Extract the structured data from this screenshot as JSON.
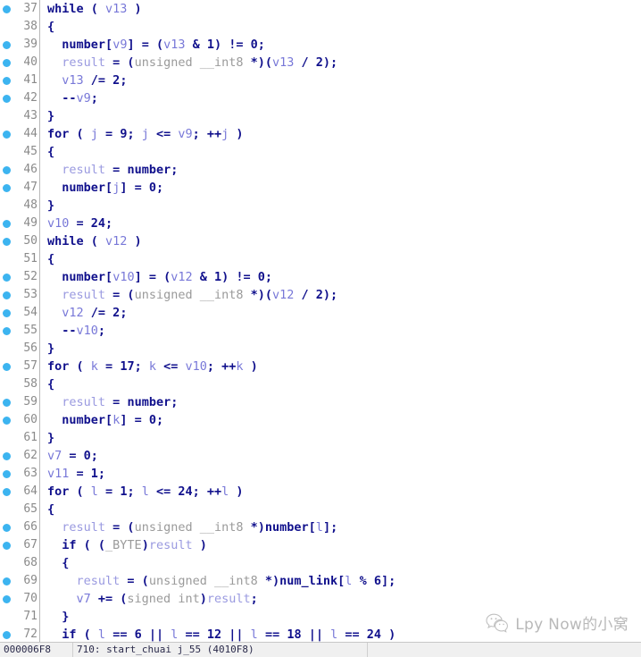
{
  "editor": {
    "name": "pseudocode-view",
    "first_line": 37,
    "lines": [
      {
        "num": 37,
        "breakpoint": true,
        "tokens": [
          {
            "t": "kw",
            "s": "while"
          },
          {
            "t": "punc",
            "s": " ( "
          },
          {
            "t": "var",
            "s": "v13"
          },
          {
            "t": "punc",
            "s": " )"
          }
        ]
      },
      {
        "num": 38,
        "breakpoint": false,
        "tokens": [
          {
            "t": "punc",
            "s": "{"
          }
        ]
      },
      {
        "num": 39,
        "breakpoint": true,
        "tokens": [
          {
            "t": "punc",
            "s": "  "
          },
          {
            "t": "ident",
            "s": "number"
          },
          {
            "t": "punc",
            "s": "["
          },
          {
            "t": "var",
            "s": "v9"
          },
          {
            "t": "punc",
            "s": "] = ("
          },
          {
            "t": "var",
            "s": "v13"
          },
          {
            "t": "punc",
            "s": " & "
          },
          {
            "t": "num",
            "s": "1"
          },
          {
            "t": "punc",
            "s": ") != "
          },
          {
            "t": "num",
            "s": "0"
          },
          {
            "t": "punc",
            "s": ";"
          }
        ]
      },
      {
        "num": 40,
        "breakpoint": true,
        "tokens": [
          {
            "t": "punc",
            "s": "  "
          },
          {
            "t": "res",
            "s": "result"
          },
          {
            "t": "punc",
            "s": " = ("
          },
          {
            "t": "type",
            "s": "unsigned __int8"
          },
          {
            "t": "punc",
            "s": " *)("
          },
          {
            "t": "var",
            "s": "v13"
          },
          {
            "t": "punc",
            "s": " / "
          },
          {
            "t": "num",
            "s": "2"
          },
          {
            "t": "punc",
            "s": ");"
          }
        ]
      },
      {
        "num": 41,
        "breakpoint": true,
        "tokens": [
          {
            "t": "punc",
            "s": "  "
          },
          {
            "t": "var",
            "s": "v13"
          },
          {
            "t": "punc",
            "s": " /= "
          },
          {
            "t": "num",
            "s": "2"
          },
          {
            "t": "punc",
            "s": ";"
          }
        ]
      },
      {
        "num": 42,
        "breakpoint": true,
        "tokens": [
          {
            "t": "punc",
            "s": "  --"
          },
          {
            "t": "var",
            "s": "v9"
          },
          {
            "t": "punc",
            "s": ";"
          }
        ]
      },
      {
        "num": 43,
        "breakpoint": false,
        "tokens": [
          {
            "t": "punc",
            "s": "}"
          }
        ]
      },
      {
        "num": 44,
        "breakpoint": true,
        "tokens": [
          {
            "t": "kw",
            "s": "for"
          },
          {
            "t": "punc",
            "s": " ( "
          },
          {
            "t": "var",
            "s": "j"
          },
          {
            "t": "punc",
            "s": " = "
          },
          {
            "t": "num",
            "s": "9"
          },
          {
            "t": "punc",
            "s": "; "
          },
          {
            "t": "var",
            "s": "j"
          },
          {
            "t": "punc",
            "s": " <= "
          },
          {
            "t": "var",
            "s": "v9"
          },
          {
            "t": "punc",
            "s": "; ++"
          },
          {
            "t": "var",
            "s": "j"
          },
          {
            "t": "punc",
            "s": " )"
          }
        ]
      },
      {
        "num": 45,
        "breakpoint": false,
        "tokens": [
          {
            "t": "punc",
            "s": "{"
          }
        ]
      },
      {
        "num": 46,
        "breakpoint": true,
        "tokens": [
          {
            "t": "punc",
            "s": "  "
          },
          {
            "t": "res",
            "s": "result"
          },
          {
            "t": "punc",
            "s": " = "
          },
          {
            "t": "ident",
            "s": "number"
          },
          {
            "t": "punc",
            "s": ";"
          }
        ]
      },
      {
        "num": 47,
        "breakpoint": true,
        "tokens": [
          {
            "t": "punc",
            "s": "  "
          },
          {
            "t": "ident",
            "s": "number"
          },
          {
            "t": "punc",
            "s": "["
          },
          {
            "t": "var",
            "s": "j"
          },
          {
            "t": "punc",
            "s": "] = "
          },
          {
            "t": "num",
            "s": "0"
          },
          {
            "t": "punc",
            "s": ";"
          }
        ]
      },
      {
        "num": 48,
        "breakpoint": false,
        "tokens": [
          {
            "t": "punc",
            "s": "}"
          }
        ]
      },
      {
        "num": 49,
        "breakpoint": true,
        "tokens": [
          {
            "t": "var",
            "s": "v10"
          },
          {
            "t": "punc",
            "s": " = "
          },
          {
            "t": "num",
            "s": "24"
          },
          {
            "t": "punc",
            "s": ";"
          }
        ]
      },
      {
        "num": 50,
        "breakpoint": true,
        "tokens": [
          {
            "t": "kw",
            "s": "while"
          },
          {
            "t": "punc",
            "s": " ( "
          },
          {
            "t": "var",
            "s": "v12"
          },
          {
            "t": "punc",
            "s": " )"
          }
        ]
      },
      {
        "num": 51,
        "breakpoint": false,
        "tokens": [
          {
            "t": "punc",
            "s": "{"
          }
        ]
      },
      {
        "num": 52,
        "breakpoint": true,
        "tokens": [
          {
            "t": "punc",
            "s": "  "
          },
          {
            "t": "ident",
            "s": "number"
          },
          {
            "t": "punc",
            "s": "["
          },
          {
            "t": "var",
            "s": "v10"
          },
          {
            "t": "punc",
            "s": "] = ("
          },
          {
            "t": "var",
            "s": "v12"
          },
          {
            "t": "punc",
            "s": " & "
          },
          {
            "t": "num",
            "s": "1"
          },
          {
            "t": "punc",
            "s": ") != "
          },
          {
            "t": "num",
            "s": "0"
          },
          {
            "t": "punc",
            "s": ";"
          }
        ]
      },
      {
        "num": 53,
        "breakpoint": true,
        "tokens": [
          {
            "t": "punc",
            "s": "  "
          },
          {
            "t": "res",
            "s": "result"
          },
          {
            "t": "punc",
            "s": " = ("
          },
          {
            "t": "type",
            "s": "unsigned __int8"
          },
          {
            "t": "punc",
            "s": " *)("
          },
          {
            "t": "var",
            "s": "v12"
          },
          {
            "t": "punc",
            "s": " / "
          },
          {
            "t": "num",
            "s": "2"
          },
          {
            "t": "punc",
            "s": ");"
          }
        ]
      },
      {
        "num": 54,
        "breakpoint": true,
        "tokens": [
          {
            "t": "punc",
            "s": "  "
          },
          {
            "t": "var",
            "s": "v12"
          },
          {
            "t": "punc",
            "s": " /= "
          },
          {
            "t": "num",
            "s": "2"
          },
          {
            "t": "punc",
            "s": ";"
          }
        ]
      },
      {
        "num": 55,
        "breakpoint": true,
        "tokens": [
          {
            "t": "punc",
            "s": "  --"
          },
          {
            "t": "var",
            "s": "v10"
          },
          {
            "t": "punc",
            "s": ";"
          }
        ]
      },
      {
        "num": 56,
        "breakpoint": false,
        "tokens": [
          {
            "t": "punc",
            "s": "}"
          }
        ]
      },
      {
        "num": 57,
        "breakpoint": true,
        "tokens": [
          {
            "t": "kw",
            "s": "for"
          },
          {
            "t": "punc",
            "s": " ( "
          },
          {
            "t": "var",
            "s": "k"
          },
          {
            "t": "punc",
            "s": " = "
          },
          {
            "t": "num",
            "s": "17"
          },
          {
            "t": "punc",
            "s": "; "
          },
          {
            "t": "var",
            "s": "k"
          },
          {
            "t": "punc",
            "s": " <= "
          },
          {
            "t": "var",
            "s": "v10"
          },
          {
            "t": "punc",
            "s": "; ++"
          },
          {
            "t": "var",
            "s": "k"
          },
          {
            "t": "punc",
            "s": " )"
          }
        ]
      },
      {
        "num": 58,
        "breakpoint": false,
        "tokens": [
          {
            "t": "punc",
            "s": "{"
          }
        ]
      },
      {
        "num": 59,
        "breakpoint": true,
        "tokens": [
          {
            "t": "punc",
            "s": "  "
          },
          {
            "t": "res",
            "s": "result"
          },
          {
            "t": "punc",
            "s": " = "
          },
          {
            "t": "ident",
            "s": "number"
          },
          {
            "t": "punc",
            "s": ";"
          }
        ]
      },
      {
        "num": 60,
        "breakpoint": true,
        "tokens": [
          {
            "t": "punc",
            "s": "  "
          },
          {
            "t": "ident",
            "s": "number"
          },
          {
            "t": "punc",
            "s": "["
          },
          {
            "t": "var",
            "s": "k"
          },
          {
            "t": "punc",
            "s": "] = "
          },
          {
            "t": "num",
            "s": "0"
          },
          {
            "t": "punc",
            "s": ";"
          }
        ]
      },
      {
        "num": 61,
        "breakpoint": false,
        "tokens": [
          {
            "t": "punc",
            "s": "}"
          }
        ]
      },
      {
        "num": 62,
        "breakpoint": true,
        "tokens": [
          {
            "t": "var",
            "s": "v7"
          },
          {
            "t": "punc",
            "s": " = "
          },
          {
            "t": "num",
            "s": "0"
          },
          {
            "t": "punc",
            "s": ";"
          }
        ]
      },
      {
        "num": 63,
        "breakpoint": true,
        "tokens": [
          {
            "t": "var",
            "s": "v11"
          },
          {
            "t": "punc",
            "s": " = "
          },
          {
            "t": "num",
            "s": "1"
          },
          {
            "t": "punc",
            "s": ";"
          }
        ]
      },
      {
        "num": 64,
        "breakpoint": true,
        "tokens": [
          {
            "t": "kw",
            "s": "for"
          },
          {
            "t": "punc",
            "s": " ( "
          },
          {
            "t": "var",
            "s": "l"
          },
          {
            "t": "punc",
            "s": " = "
          },
          {
            "t": "num",
            "s": "1"
          },
          {
            "t": "punc",
            "s": "; "
          },
          {
            "t": "var",
            "s": "l"
          },
          {
            "t": "punc",
            "s": " <= "
          },
          {
            "t": "num",
            "s": "24"
          },
          {
            "t": "punc",
            "s": "; ++"
          },
          {
            "t": "var",
            "s": "l"
          },
          {
            "t": "punc",
            "s": " )"
          }
        ]
      },
      {
        "num": 65,
        "breakpoint": false,
        "tokens": [
          {
            "t": "punc",
            "s": "{"
          }
        ]
      },
      {
        "num": 66,
        "breakpoint": true,
        "tokens": [
          {
            "t": "punc",
            "s": "  "
          },
          {
            "t": "res",
            "s": "result"
          },
          {
            "t": "punc",
            "s": " = ("
          },
          {
            "t": "type",
            "s": "unsigned __int8"
          },
          {
            "t": "punc",
            "s": " *)"
          },
          {
            "t": "ident",
            "s": "number"
          },
          {
            "t": "punc",
            "s": "["
          },
          {
            "t": "var",
            "s": "l"
          },
          {
            "t": "punc",
            "s": "];"
          }
        ]
      },
      {
        "num": 67,
        "breakpoint": true,
        "tokens": [
          {
            "t": "punc",
            "s": "  "
          },
          {
            "t": "kw",
            "s": "if"
          },
          {
            "t": "punc",
            "s": " ( ("
          },
          {
            "t": "type",
            "s": "_BYTE"
          },
          {
            "t": "punc",
            "s": ")"
          },
          {
            "t": "res",
            "s": "result"
          },
          {
            "t": "punc",
            "s": " )"
          }
        ]
      },
      {
        "num": 68,
        "breakpoint": false,
        "tokens": [
          {
            "t": "punc",
            "s": "  {"
          }
        ]
      },
      {
        "num": 69,
        "breakpoint": true,
        "tokens": [
          {
            "t": "punc",
            "s": "    "
          },
          {
            "t": "res",
            "s": "result"
          },
          {
            "t": "punc",
            "s": " = ("
          },
          {
            "t": "type",
            "s": "unsigned __int8"
          },
          {
            "t": "punc",
            "s": " *)"
          },
          {
            "t": "ident",
            "s": "num_link"
          },
          {
            "t": "punc",
            "s": "["
          },
          {
            "t": "var",
            "s": "l"
          },
          {
            "t": "punc",
            "s": " % "
          },
          {
            "t": "num",
            "s": "6"
          },
          {
            "t": "punc",
            "s": "];"
          }
        ]
      },
      {
        "num": 70,
        "breakpoint": true,
        "tokens": [
          {
            "t": "punc",
            "s": "    "
          },
          {
            "t": "var",
            "s": "v7"
          },
          {
            "t": "punc",
            "s": " += ("
          },
          {
            "t": "type",
            "s": "signed int"
          },
          {
            "t": "punc",
            "s": ")"
          },
          {
            "t": "res",
            "s": "result"
          },
          {
            "t": "punc",
            "s": ";"
          }
        ]
      },
      {
        "num": 71,
        "breakpoint": false,
        "tokens": [
          {
            "t": "punc",
            "s": "  }"
          }
        ]
      },
      {
        "num": 72,
        "breakpoint": true,
        "tokens": [
          {
            "t": "punc",
            "s": "  "
          },
          {
            "t": "kw",
            "s": "if"
          },
          {
            "t": "punc",
            "s": " ( "
          },
          {
            "t": "var",
            "s": "l"
          },
          {
            "t": "punc",
            "s": " == "
          },
          {
            "t": "num",
            "s": "6"
          },
          {
            "t": "punc",
            "s": " || "
          },
          {
            "t": "var",
            "s": "l"
          },
          {
            "t": "punc",
            "s": " == "
          },
          {
            "t": "num",
            "s": "12"
          },
          {
            "t": "punc",
            "s": " || "
          },
          {
            "t": "var",
            "s": "l"
          },
          {
            "t": "punc",
            "s": " == "
          },
          {
            "t": "num",
            "s": "18"
          },
          {
            "t": "punc",
            "s": " || "
          },
          {
            "t": "var",
            "s": "l"
          },
          {
            "t": "punc",
            "s": " == "
          },
          {
            "t": "num",
            "s": "24"
          },
          {
            "t": "punc",
            "s": " )"
          }
        ]
      }
    ]
  },
  "status_bar": {
    "address": "000006F8",
    "info": "710: start_chuai j_55 (4010F8)"
  },
  "watermark": {
    "text": "Lpy Now的小窝",
    "icon": "wechat-icon"
  },
  "colors": {
    "keyword": "#10108c",
    "variable": "#7878d8",
    "result": "#9a9ae0",
    "type": "#9a9a9a",
    "breakpoint_dot": "#3cb4f0",
    "gutter_text": "#8a8a8a",
    "background": "#ffffff",
    "status_bg": "#f0f0f0"
  }
}
